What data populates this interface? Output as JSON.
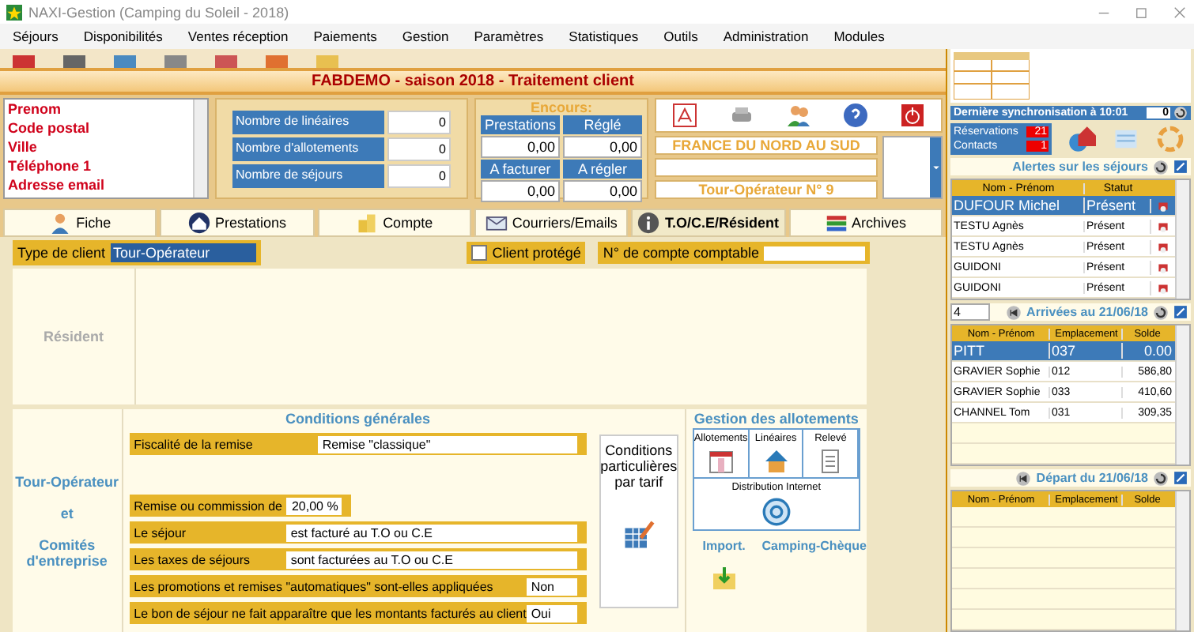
{
  "window": {
    "title": "NAXI-Gestion (Camping du Soleil - 2018)"
  },
  "menu": [
    "Séjours",
    "Disponibilités",
    "Ventes réception",
    "Paiements",
    "Gestion",
    "Paramètres",
    "Statistiques",
    "Outils",
    "Administration",
    "Modules"
  ],
  "header": {
    "title": "FABDEMO - saison 2018 - Traitement client"
  },
  "contact_fields": [
    "Prenom",
    "Code postal",
    "Ville",
    "Téléphone 1",
    "Adresse email"
  ],
  "counters": [
    {
      "label": "Nombre de linéaires",
      "value": "0"
    },
    {
      "label": "Nombre d'allotements",
      "value": "0"
    },
    {
      "label": "Nombre de séjours",
      "value": "0"
    }
  ],
  "encours": {
    "title": "Encours:",
    "cells": [
      {
        "label": "Prestations",
        "value": "0,00"
      },
      {
        "label": "Réglé",
        "value": "0,00"
      },
      {
        "label": "A facturer",
        "value": "0,00"
      },
      {
        "label": "A régler",
        "value": "0,00"
      }
    ]
  },
  "client_info": {
    "region": "FRANCE DU NORD AU SUD",
    "operator": "Tour-Opérateur N° 9"
  },
  "tabs": [
    {
      "label": "Fiche",
      "selected": false
    },
    {
      "label": "Prestations",
      "selected": false
    },
    {
      "label": "Compte",
      "selected": false
    },
    {
      "label": "Courriers/Emails",
      "selected": false
    },
    {
      "label": "T.O/C.E/Résident",
      "selected": true
    },
    {
      "label": "Archives",
      "selected": false
    }
  ],
  "type_client": {
    "label": "Type de client",
    "value": "Tour-Opérateur"
  },
  "client_protege": {
    "label": "Client protégé",
    "checked": false
  },
  "compte_comptable": {
    "label": "N° de compte comptable"
  },
  "resident": {
    "label": "Résident"
  },
  "to_label": [
    "Tour-Opérateur",
    "et",
    "Comités d'entreprise"
  ],
  "conditions": {
    "title": "Conditions générales",
    "rows": [
      {
        "kind": "select",
        "label": "Fiscalité de la remise",
        "value": "Remise \"classique\""
      },
      {
        "kind": "percent",
        "label": "Remise ou commission de",
        "value": "20,00 %"
      },
      {
        "kind": "select",
        "label": "Le séjour",
        "value": "est facturé au T.O ou C.E"
      },
      {
        "kind": "select",
        "label": "Les taxes de séjours",
        "value": "sont facturées au T.O ou C.E"
      },
      {
        "kind": "small",
        "label": "Les promotions et remises \"automatiques\" sont-elles appliquées",
        "value": "Non"
      },
      {
        "kind": "small",
        "label": "Le bon de séjour ne fait apparaître que les montants facturés au client",
        "value": "Oui"
      }
    ]
  },
  "conditions_tarif": "Conditions particulières par tarif",
  "allotements": {
    "title": "Gestion des allotements",
    "items": [
      "Allotements",
      "Linéaires",
      "Relevé"
    ],
    "distribution": "Distribution Internet"
  },
  "import": "Import.",
  "camping_cheque": "Camping-Chèque",
  "sync": {
    "label": "Dernière synchronisation à 10:01",
    "value": "0"
  },
  "counts": [
    {
      "label": "Réservations",
      "value": "21"
    },
    {
      "label": "Contacts",
      "value": "1"
    }
  ],
  "alerts": {
    "title": "Alertes sur les séjours",
    "columns": [
      "Nom - Prénom",
      "Statut"
    ],
    "rows": [
      {
        "name": "DUFOUR Michel",
        "status": "Présent",
        "selected": true
      },
      {
        "name": "TESTU Agnès",
        "status": "Présent",
        "selected": false
      },
      {
        "name": "TESTU Agnès",
        "status": "Présent",
        "selected": false
      },
      {
        "name": "GUIDONI",
        "status": "Présent",
        "selected": false
      },
      {
        "name": "GUIDONI",
        "status": "Présent",
        "selected": false
      }
    ]
  },
  "arrivals": {
    "count": "4",
    "title": "Arrivées au 21/06/18",
    "columns": [
      "Nom - Prénom",
      "Emplacement",
      "Solde"
    ],
    "rows": [
      {
        "name": "PITT",
        "place": "037",
        "balance": "0.00",
        "selected": true
      },
      {
        "name": "GRAVIER Sophie",
        "place": "012",
        "balance": "586,80",
        "selected": false
      },
      {
        "name": "GRAVIER Sophie",
        "place": "033",
        "balance": "410,60",
        "selected": false
      },
      {
        "name": "CHANNEL Tom",
        "place": "031",
        "balance": "309,35",
        "selected": false
      }
    ]
  },
  "departures": {
    "title": "Départ du 21/06/18",
    "columns": [
      "Nom - Prénom",
      "Emplacement",
      "Solde"
    ]
  }
}
